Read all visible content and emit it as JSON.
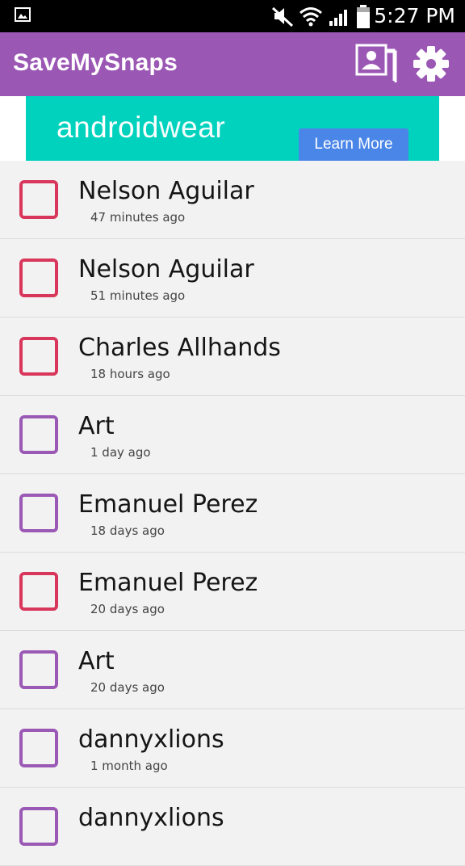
{
  "status_bar": {
    "time": "5:27 PM",
    "icons": [
      "gallery-icon",
      "mute-icon",
      "wifi-icon",
      "signal-icon",
      "battery-icon"
    ]
  },
  "app_bar": {
    "title": "SaveMySnaps",
    "color": "#9b57b4",
    "actions": [
      "gallery-icon",
      "settings-icon"
    ]
  },
  "ad": {
    "brand_part1": "android",
    "brand_part2": "wear",
    "cta": "Learn More",
    "background": "#00d2be"
  },
  "snaps": [
    {
      "name": "Nelson Aguilar",
      "time": "47 minutes ago",
      "type": "red"
    },
    {
      "name": "Nelson Aguilar",
      "time": "51 minutes ago",
      "type": "red"
    },
    {
      "name": "Charles Allhands",
      "time": "18 hours ago",
      "type": "red"
    },
    {
      "name": "Art",
      "time": "1 day ago",
      "type": "purple"
    },
    {
      "name": "Emanuel Perez",
      "time": "18 days ago",
      "type": "purple"
    },
    {
      "name": "Emanuel Perez",
      "time": "20 days ago",
      "type": "red"
    },
    {
      "name": "Art",
      "time": "20 days ago",
      "type": "purple"
    },
    {
      "name": "dannyxlions",
      "time": "1 month ago",
      "type": "purple"
    },
    {
      "name": "dannyxlions",
      "time": "",
      "type": "purple"
    }
  ],
  "colors": {
    "red": "#d8365b",
    "purple": "#9b59b6"
  }
}
